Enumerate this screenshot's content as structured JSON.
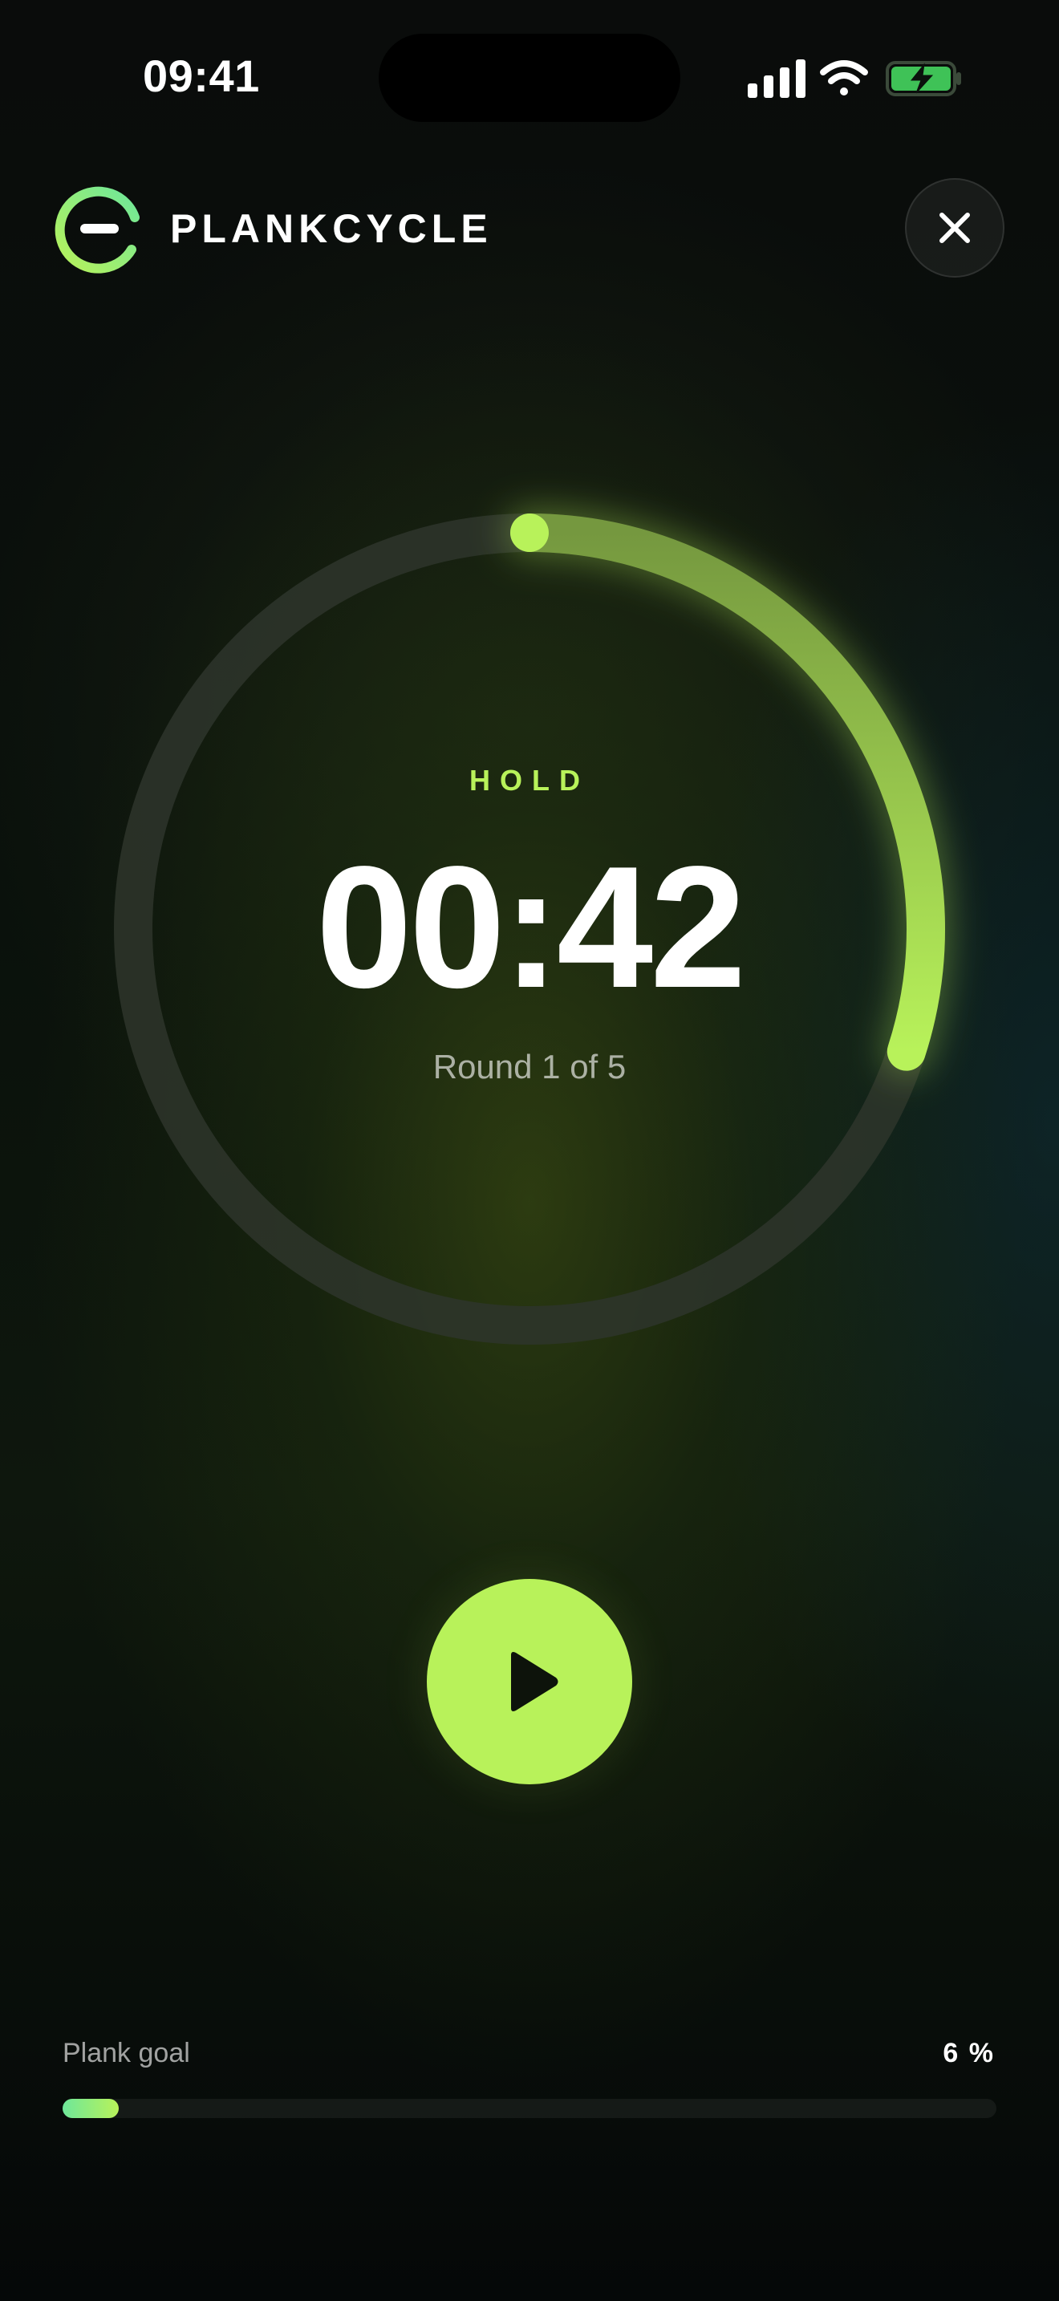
{
  "status_bar": {
    "time": "09:41",
    "icons": [
      "signal-icon",
      "wifi-icon",
      "battery-charging-icon"
    ]
  },
  "header": {
    "brand_name": "PLANKCYCLE",
    "logo_icon": "plankcycle-logo-icon",
    "close_icon": "close-icon"
  },
  "timer": {
    "phase": "HOLD",
    "time": "00:42",
    "round_label": "Round 1 of 5",
    "progress_fraction": 0.3
  },
  "controls": {
    "play_icon": "play-icon"
  },
  "goal": {
    "label": "Plank goal",
    "value_label": "6 %",
    "progress_percent": 6
  },
  "colors": {
    "accent": "#b8f25a",
    "accent_secondary": "#6ee79a",
    "background": "#050807",
    "ring_track": "#2e352c"
  }
}
